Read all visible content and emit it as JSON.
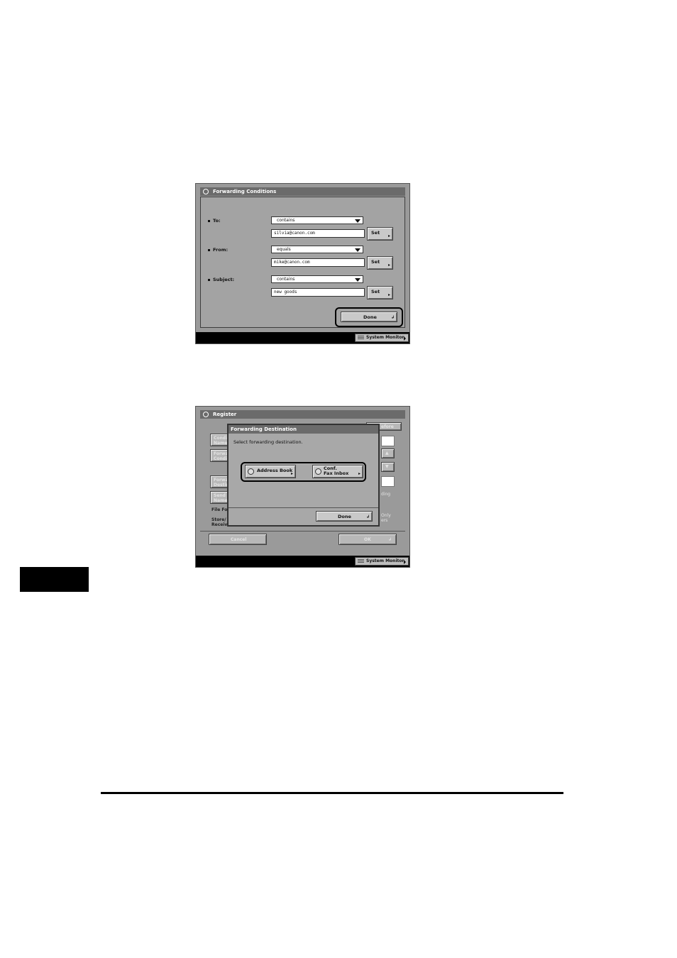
{
  "screen1": {
    "title": "Forwarding Conditions",
    "rows": [
      {
        "label": "To:",
        "operator": "contains",
        "value": "silvia@canon.com",
        "set_label": "Set"
      },
      {
        "label": "From:",
        "operator": "equals",
        "value": "mike@canon.com",
        "set_label": "Set"
      },
      {
        "label": "Subject:",
        "operator": "contains",
        "value": "new goods",
        "set_label": "Set"
      }
    ],
    "done_label": "Done",
    "system_monitor": "System Monitor"
  },
  "screen2": {
    "title": "Register",
    "dialog": {
      "title": "Forwarding Destination",
      "message": "Select forwarding destination.",
      "address_book": "Address Book",
      "conf_fax_inbox_line1": "Conf.",
      "conf_fax_inbox_line2": "Fax Inbox",
      "done_label": "Done"
    },
    "background": {
      "cond_name": [
        "Condi",
        "Name"
      ],
      "forw_cond": [
        "Forwa",
        "Condi"
      ],
      "forw_dest": [
        "Forwa",
        "Destin"
      ],
      "send_name": [
        "Send",
        "Name"
      ],
      "file_fo": "File Fo",
      "store_receiv": [
        "Store/",
        "Receiv"
      ],
      "before": "efore",
      "ding": "ding",
      "only": "Only",
      "ers": "ers"
    },
    "cancel_label": "Cancel",
    "ok_label": "OK",
    "system_monitor": "System Monitor"
  }
}
